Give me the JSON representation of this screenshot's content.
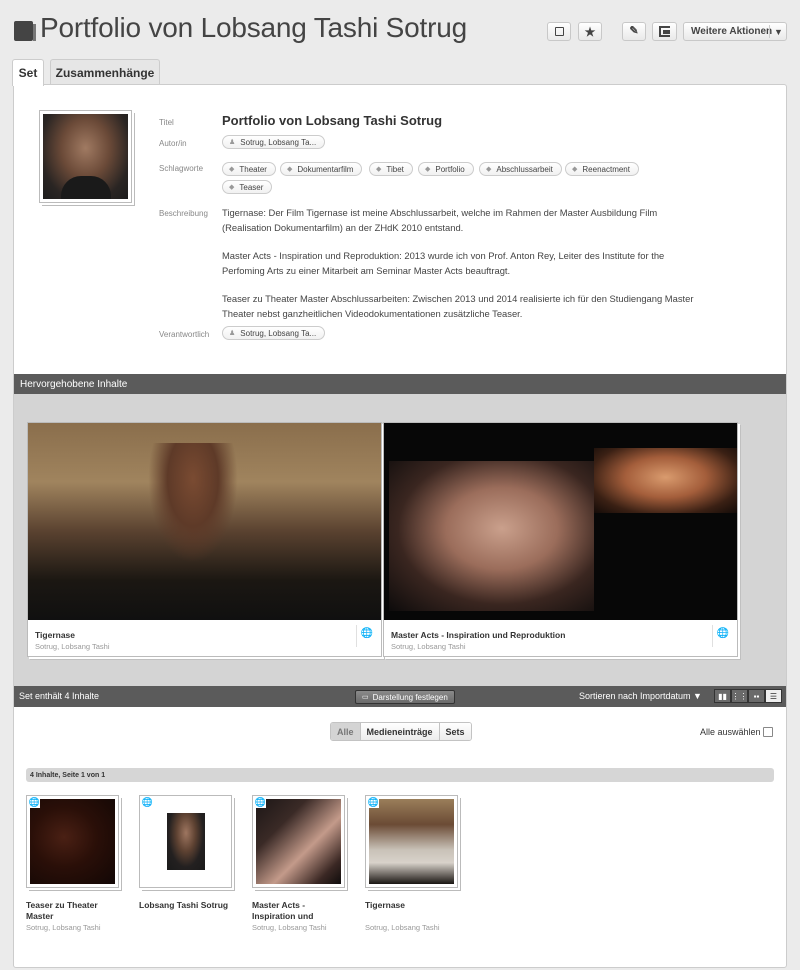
{
  "header": {
    "title": "Portfolio von Lobsang Tashi Sotrug",
    "more_actions_label": "Weitere Aktionen",
    "icons": [
      "select-square-icon",
      "star-icon",
      "pencil-icon",
      "export-icon",
      "caret-down-icon"
    ]
  },
  "tabs": [
    {
      "label": "Set",
      "active": true
    },
    {
      "label": "Zusammenhänge",
      "active": false
    }
  ],
  "meta": {
    "title_label": "Titel",
    "title_value": "Portfolio von Lobsang Tashi Sotrug",
    "author_label": "Autor/in",
    "author_value": "Sotrug, Lobsang Ta...",
    "keywords_label": "Schlagworte",
    "keywords": [
      "Theater",
      "Dokumentarfilm",
      "Tibet",
      "Portfolio",
      "Abschlussarbeit",
      "Reenactment",
      "Teaser"
    ],
    "description_label": "Beschreibung",
    "description": [
      "Tigernase: Der Film Tigernase ist meine Abschlussarbeit, welche im Rahmen der Master Ausbildung Film (Realisation Dokumentarfilm) an der ZHdK 2010 entstand.",
      "Master Acts - Inspiration und Reproduktion: 2013 wurde ich von Prof. Anton Rey, Leiter des Institute for the Perfoming Arts zu einer Mitarbeit am Seminar Master Acts beauftragt.",
      "Teaser zu Theater Master Abschlussarbeiten: Zwischen 2013 und 2014 realisierte ich für den Studiengang Master Theater nebst ganzheitlichen Videodokumentationen zusätzliche Teaser."
    ],
    "responsible_label": "Verantwortlich",
    "responsible_value": "Sotrug, Lobsang Ta..."
  },
  "highlights": {
    "bar_label": "Hervorgehobene Inhalte",
    "items": [
      {
        "title": "Tigernase",
        "author": "Sotrug, Lobsang Tashi"
      },
      {
        "title": "Master Acts - Inspiration und Reproduktion",
        "author": "Sotrug, Lobsang Tashi"
      }
    ]
  },
  "set_bar": {
    "count_label": "Set enthält 4 Inhalte",
    "layout_button": "Darstellung festlegen",
    "sort_label": "Sortieren nach Importdatum ▼"
  },
  "filters": {
    "options": [
      "Alle",
      "Medieneinträge",
      "Sets"
    ],
    "active": "Alle",
    "select_all_label": "Alle auswählen"
  },
  "pagination": "4 Inhalte, Seite 1 von 1",
  "items": [
    {
      "title": "Teaser zu Theater Master",
      "author": "Sotrug, Lobsang Tashi"
    },
    {
      "title": "Lobsang Tashi Sotrug",
      "author": ""
    },
    {
      "title": "Master Acts - Inspiration und",
      "author": "Sotrug, Lobsang Tashi"
    },
    {
      "title": "Tigernase",
      "author": "Sotrug, Lobsang Tashi"
    }
  ]
}
